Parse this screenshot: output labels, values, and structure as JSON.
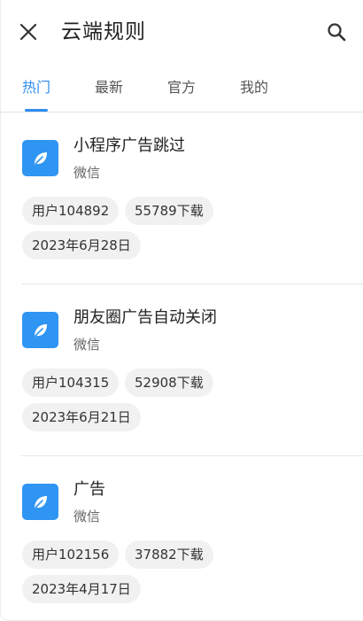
{
  "header": {
    "title": "云端规则",
    "close_icon": "close-icon",
    "search_icon": "search-icon"
  },
  "tabs": [
    {
      "label": "热门",
      "active": true
    },
    {
      "label": "最新",
      "active": false
    },
    {
      "label": "官方",
      "active": false
    },
    {
      "label": "我的",
      "active": false
    }
  ],
  "colors": {
    "accent": "#2f8cf0",
    "icon_bg": "#2f95f2",
    "chip_bg": "#f1f1f1"
  },
  "rules": [
    {
      "title": "小程序广告跳过",
      "app": "微信",
      "user": "用户104892",
      "downloads": "55789下载",
      "date": "2023年6月28日",
      "icon": "leaf-icon"
    },
    {
      "title": "朋友圈广告自动关闭",
      "app": "微信",
      "user": "用户104315",
      "downloads": "52908下载",
      "date": "2023年6月21日",
      "icon": "leaf-icon"
    },
    {
      "title": "广告",
      "app": "微信",
      "user": "用户102156",
      "downloads": "37882下载",
      "date": "2023年4月17日",
      "icon": "leaf-icon"
    }
  ]
}
